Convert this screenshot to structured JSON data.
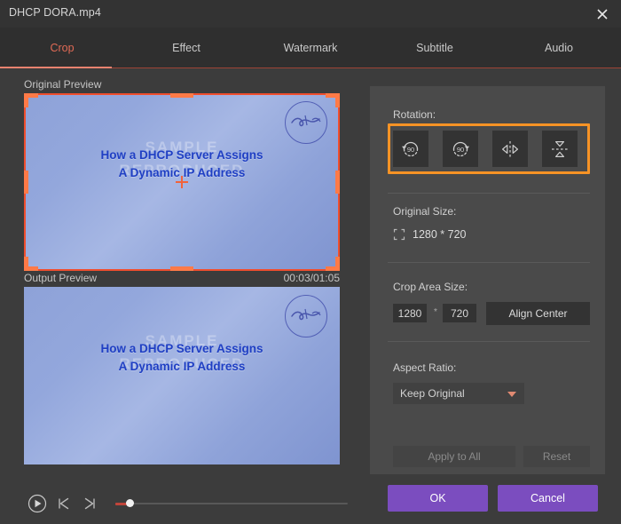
{
  "window": {
    "title": "DHCP DORA.mp4",
    "close_icon": "close-icon"
  },
  "tabs": [
    {
      "label": "Crop",
      "active": true
    },
    {
      "label": "Effect",
      "active": false
    },
    {
      "label": "Watermark",
      "active": false
    },
    {
      "label": "Subtitle",
      "active": false
    },
    {
      "label": "Audio",
      "active": false
    }
  ],
  "preview": {
    "original_label": "Original Preview",
    "output_label": "Output Preview",
    "time": "00:03/01:05",
    "video_title_line1": "How a DHCP Server Assigns",
    "video_title_line2": "A Dynamic IP Address",
    "watermark_line1": "SAMPLE",
    "watermark_line2": "REPRODUCED"
  },
  "playback": {
    "play_icon": "play-icon",
    "prev_icon": "previous-frame-icon",
    "next_icon": "next-frame-icon",
    "progress_percent": 5
  },
  "panel": {
    "rotation": {
      "label": "Rotation:",
      "buttons": [
        {
          "name": "rotate-counterclockwise-90",
          "degrees": "90"
        },
        {
          "name": "rotate-clockwise-90",
          "degrees": "90"
        },
        {
          "name": "flip-horizontal",
          "degrees": ""
        },
        {
          "name": "flip-vertical",
          "degrees": ""
        }
      ],
      "highlight_color": "#f79325"
    },
    "original_size": {
      "label": "Original Size:",
      "icon": "resize-icon",
      "value": "1280 * 720"
    },
    "crop_area_size": {
      "label": "Crop Area Size:",
      "width": "1280",
      "height": "720",
      "separator": "*",
      "align_center_label": "Align Center"
    },
    "aspect_ratio": {
      "label": "Aspect Ratio:",
      "selected": "Keep Original",
      "options": [
        "Keep Original"
      ]
    },
    "apply_to_all_label": "Apply to All",
    "reset_label": "Reset"
  },
  "actions": {
    "ok_label": "OK",
    "cancel_label": "Cancel",
    "accent_color": "#7b4dbf"
  }
}
